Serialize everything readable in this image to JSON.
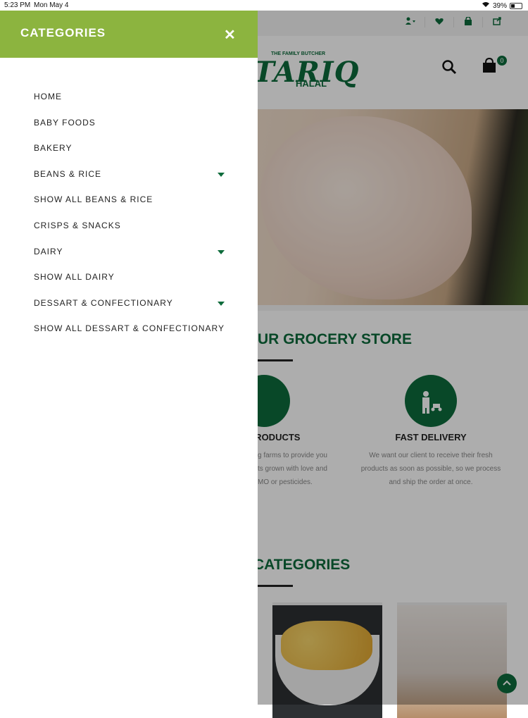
{
  "status_bar": {
    "time": "5:23 PM",
    "date": "Mon May 4",
    "battery": "39%"
  },
  "drawer": {
    "title": "CATEGORIES",
    "close_glyph": "✕",
    "items": [
      {
        "label": "HOME",
        "has_submenu": false
      },
      {
        "label": "BABY FOODS",
        "has_submenu": false
      },
      {
        "label": "BAKERY",
        "has_submenu": false
      },
      {
        "label": "BEANS & RICE",
        "has_submenu": true
      },
      {
        "label": "SHOW ALL BEANS & RICE",
        "has_submenu": false
      },
      {
        "label": "CRISPS & SNACKS",
        "has_submenu": false
      },
      {
        "label": "DAIRY",
        "has_submenu": true
      },
      {
        "label": "SHOW ALL DAIRY",
        "has_submenu": false
      },
      {
        "label": "DESSART & CONFECTIONARY",
        "has_submenu": true
      },
      {
        "label": "SHOW ALL DESSART & CONFECTIONARY",
        "has_submenu": false
      }
    ]
  },
  "header": {
    "logo_tagline": "THE FAMILY BUTCHER",
    "logo_main": "TARIQ",
    "logo_sub": "HALAL",
    "cart_count": "0"
  },
  "sections": {
    "store_title": "UR GROCERY STORE",
    "features": [
      {
        "title": "PRODUCTS",
        "text_lines": [
          "g farms to provide you",
          "ts grown with love and",
          "MO or pesticides."
        ]
      },
      {
        "title": "FAST DELIVERY",
        "text_lines": [
          "We want our client to receive their fresh",
          "products as soon as possible, so we process",
          "and ship the order at once."
        ]
      }
    ],
    "categories_title": "CATEGORIES"
  },
  "colors": {
    "drawer_header": "#8cb43f",
    "brand_green": "#0d6b3b"
  },
  "icons": [
    "user-icon",
    "heart-icon",
    "bag-icon",
    "share-icon",
    "search-icon",
    "cart-icon",
    "close-icon",
    "caret-down-icon",
    "arrow-up-icon"
  ]
}
